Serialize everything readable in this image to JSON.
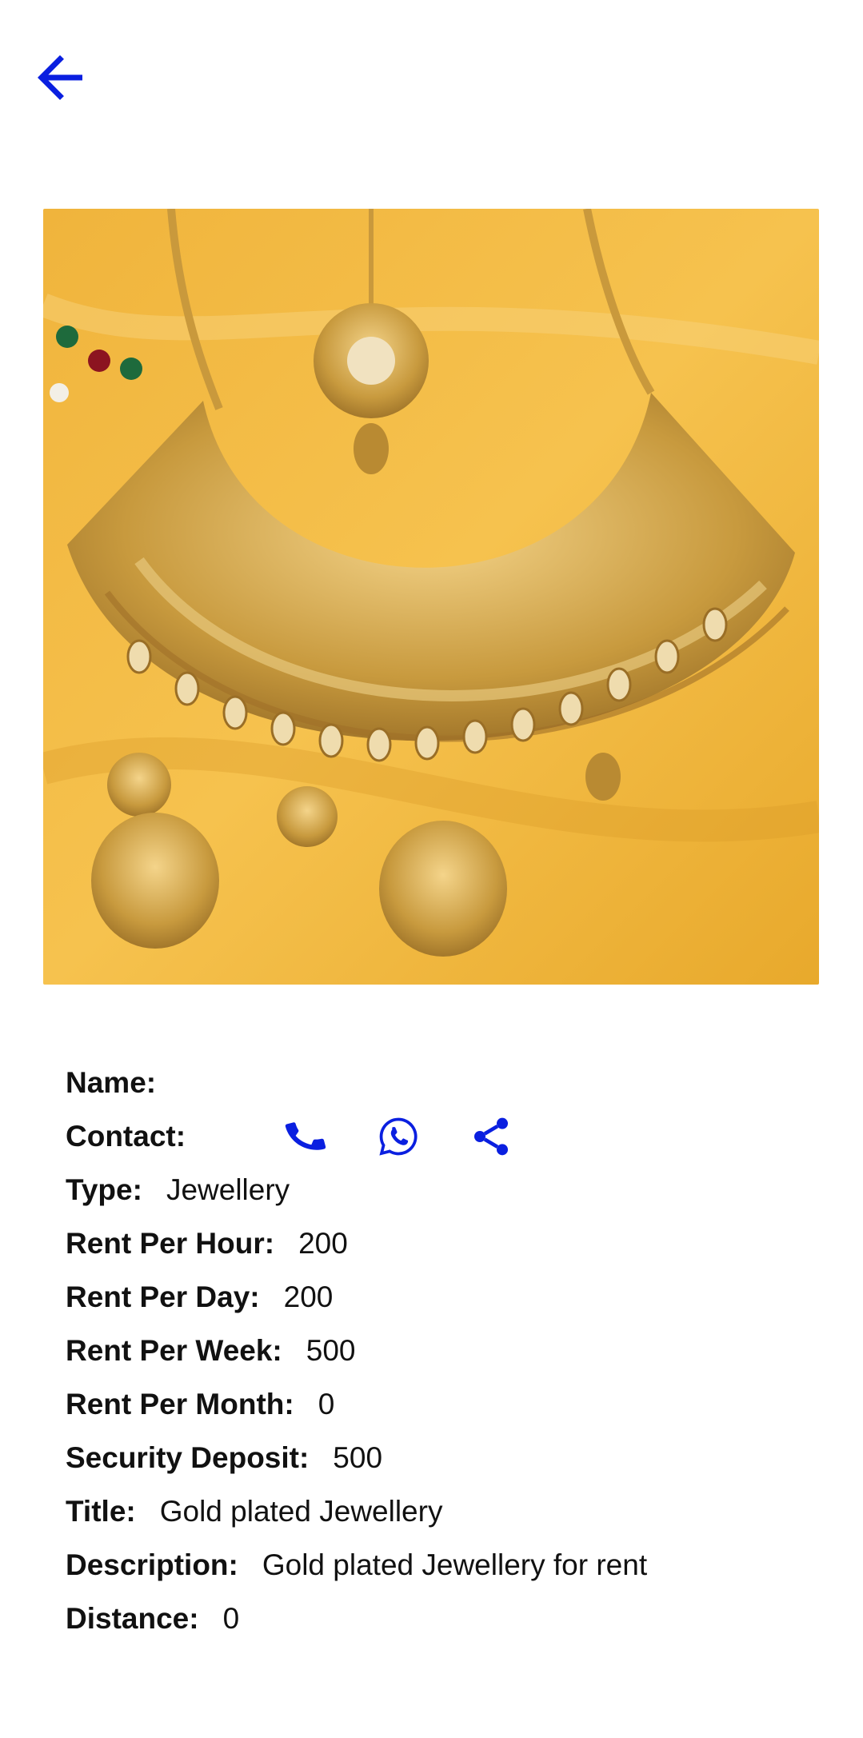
{
  "colors": {
    "accent": "#0a1fe0",
    "text": "#111111",
    "background": "#ffffff"
  },
  "header": {
    "back_icon": "arrow-left-icon"
  },
  "product": {
    "image_description_icon": "gold-necklace-photo"
  },
  "details": {
    "name": {
      "label": "Name:",
      "value": ""
    },
    "contact": {
      "label": "Contact:",
      "icons": [
        "phone-icon",
        "whatsapp-icon",
        "share-icon"
      ]
    },
    "type": {
      "label": "Type:",
      "value": "Jewellery"
    },
    "rent_hour": {
      "label": "Rent Per Hour:",
      "value": "200"
    },
    "rent_day": {
      "label": "Rent Per Day:",
      "value": "200"
    },
    "rent_week": {
      "label": "Rent Per Week:",
      "value": "500"
    },
    "rent_month": {
      "label": "Rent Per Month:",
      "value": "0"
    },
    "deposit": {
      "label": "Security Deposit:",
      "value": "500"
    },
    "title": {
      "label": "Title:",
      "value": "Gold plated Jewellery"
    },
    "description": {
      "label": "Description:",
      "value": "Gold plated Jewellery for rent"
    },
    "distance": {
      "label": "Distance:",
      "value": "0"
    }
  }
}
